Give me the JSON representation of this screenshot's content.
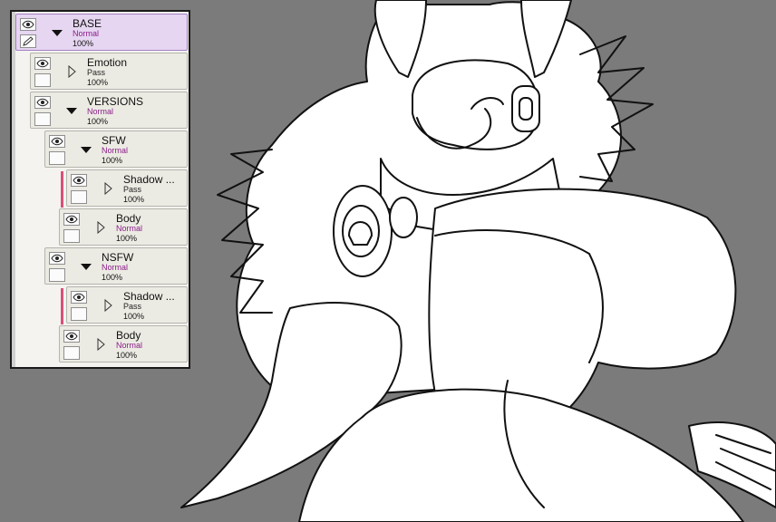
{
  "layers": [
    {
      "name": "BASE",
      "mode": "Normal",
      "opacity": "100%",
      "expanded": true,
      "selected": true,
      "depth": 0
    },
    {
      "name": "Emotion",
      "mode": "Pass",
      "opacity": "100%",
      "expanded": false,
      "selected": false,
      "depth": 1
    },
    {
      "name": "VERSIONS",
      "mode": "Normal",
      "opacity": "100%",
      "expanded": true,
      "selected": false,
      "depth": 1
    },
    {
      "name": "SFW",
      "mode": "Normal",
      "opacity": "100%",
      "expanded": true,
      "selected": false,
      "depth": 2
    },
    {
      "name": "Shadow ...",
      "mode": "Pass",
      "opacity": "100%",
      "expanded": false,
      "selected": false,
      "depth": 3,
      "clipped": true
    },
    {
      "name": "Body",
      "mode": "Normal",
      "opacity": "100%",
      "expanded": false,
      "selected": false,
      "depth": 3
    },
    {
      "name": "NSFW",
      "mode": "Normal",
      "opacity": "100%",
      "expanded": true,
      "selected": false,
      "depth": 2
    },
    {
      "name": "Shadow ...",
      "mode": "Pass",
      "opacity": "100%",
      "expanded": false,
      "selected": false,
      "depth": 3,
      "clipped": true
    },
    {
      "name": "Body",
      "mode": "Normal",
      "opacity": "100%",
      "expanded": false,
      "selected": false,
      "depth": 3
    }
  ],
  "colors": {
    "canvas_background": "#7b7b7b",
    "selected_row": "#e6d6f1",
    "normal_mode_text": "#8a1c8a",
    "clipping_marker": "#d9507a"
  },
  "icons": {
    "visibility": "eye-icon",
    "pen": "pen-icon",
    "expanded": "triangle-down-icon",
    "collapsed": "triangle-right-icon"
  }
}
